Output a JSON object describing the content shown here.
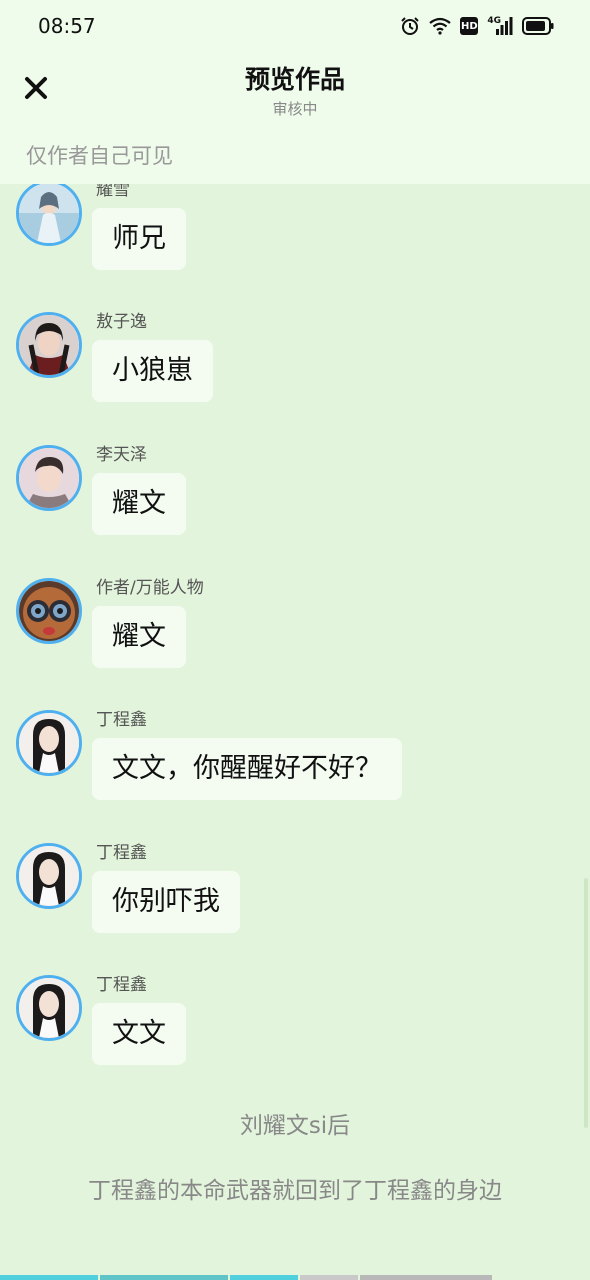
{
  "status_bar": {
    "time": "08:57",
    "icons": [
      "alarm-icon",
      "wifi-icon",
      "hd-icon",
      "signal-4g-icon",
      "battery-icon"
    ],
    "hd_label": "HD",
    "network_label": "4G"
  },
  "header": {
    "title": "预览作品",
    "subtitle": "审核中",
    "close_icon": "close-icon"
  },
  "visibility_note": "仅作者自己可见",
  "messages": [
    {
      "speaker": "耀雪",
      "text": "师兄"
    },
    {
      "speaker": "敖子逸",
      "text": "小狼崽"
    },
    {
      "speaker": "李天泽",
      "text": "耀文"
    },
    {
      "speaker": "作者/万能人物",
      "text": "耀文"
    },
    {
      "speaker": "丁程鑫",
      "text": "文文，你醒醒好不好？"
    },
    {
      "speaker": "丁程鑫",
      "text": "你别吓我"
    },
    {
      "speaker": "丁程鑫",
      "text": "文文"
    }
  ],
  "narration": [
    "刘耀文si后",
    "丁程鑫的本命武器就回到了丁程鑫的身边"
  ],
  "colors": {
    "header_bg": "#effbeb",
    "feed_bg": "#e3f4dc",
    "bubble_bg": "#f4fcf2",
    "avatar_ring": "#4fb0f0",
    "progress_active": "#4fd0dc",
    "progress_inactive": "#b8b8b8"
  }
}
